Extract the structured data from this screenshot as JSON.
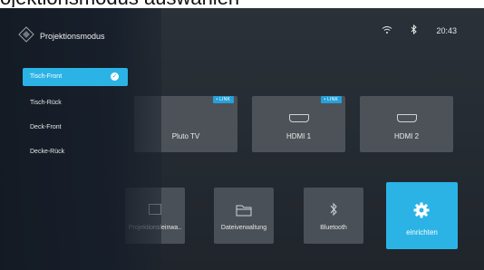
{
  "caption": "ojektionsmodus auswählen",
  "status": {
    "wifi_icon": "wifi-icon",
    "bluetooth_icon": "bluetooth-icon",
    "time": "20:43"
  },
  "panel": {
    "title": "Projektionsmodus",
    "items": [
      {
        "label": "Tisch-Front",
        "selected": true
      },
      {
        "label": "Tisch-Rück",
        "selected": false
      },
      {
        "label": "Deck-Front",
        "selected": false
      },
      {
        "label": "Decke-Rück",
        "selected": false
      }
    ]
  },
  "top_tiles": [
    {
      "label": "Pluto TV",
      "badge": "• LINK"
    },
    {
      "label": "HDMI 1",
      "badge": "• LINK"
    },
    {
      "label": "HDMI 2",
      "badge": ""
    }
  ],
  "bottom_tiles": [
    {
      "label": "Projektionsleinwa.."
    },
    {
      "label": "Dateiverwaltung"
    },
    {
      "label": "Bluetooth"
    },
    {
      "label": "einrichten"
    }
  ],
  "colors": {
    "accent": "#2bb3e6",
    "badge": "#25a0d8",
    "tile": "#4c5258",
    "background": "#252b31"
  }
}
